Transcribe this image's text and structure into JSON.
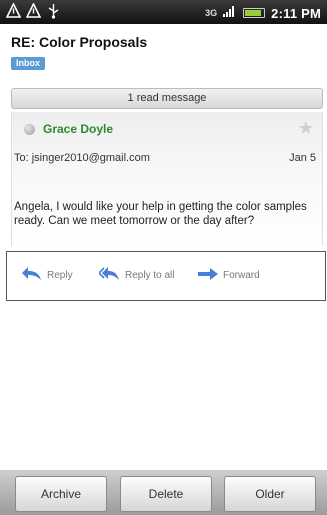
{
  "status_bar": {
    "network": "3G",
    "time": "2:11 PM",
    "icons": [
      "warning-icon",
      "warning-icon",
      "usb-icon",
      "signal-icon",
      "battery-icon"
    ]
  },
  "header": {
    "subject": "RE: Color Proposals",
    "folder": "Inbox"
  },
  "read_bar": {
    "label": "1 read message"
  },
  "message": {
    "sender": "Grace Doyle",
    "to": "To: jsinger2010@gmail.com",
    "date": "Jan 5",
    "body": "Angela, I would like your help in getting the color samples ready. Can we meet tomorrow or the day after?"
  },
  "actions": {
    "reply": "Reply",
    "reply_all": "Reply to all",
    "forward": "Forward"
  },
  "bottom": {
    "archive": "Archive",
    "delete": "Delete",
    "older": "Older"
  },
  "colors": {
    "sender": "#2c8a2c",
    "badge": "#5a9bd5",
    "action_icon": "#4a7fd6"
  }
}
